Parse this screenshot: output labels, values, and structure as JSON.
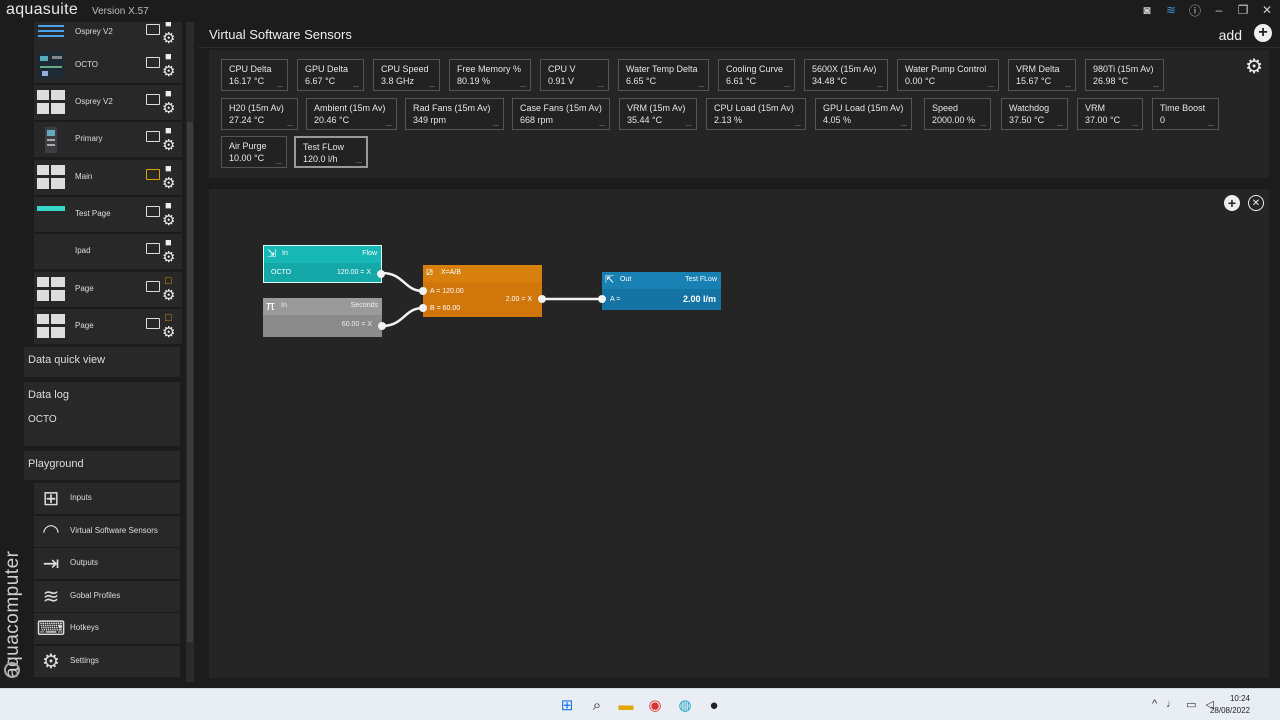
{
  "app": {
    "name": "aquasuite",
    "version": "Version X.57",
    "brand": "aquacomputer"
  },
  "pages": [
    {
      "label": "Osprey V2",
      "thumb": "blue-lines",
      "locked": true,
      "monitor_active": false
    },
    {
      "label": "OCTO",
      "thumb": "circuit",
      "locked": true,
      "monitor_active": false
    },
    {
      "label": "Osprey V2",
      "thumb": "grid",
      "locked": true,
      "monitor_active": false
    },
    {
      "label": "Primary",
      "thumb": "device",
      "locked": true,
      "monitor_active": false
    },
    {
      "label": "Main",
      "thumb": "grid",
      "locked": true,
      "monitor_active": true
    },
    {
      "label": "Test Page",
      "thumb": "teal-bar",
      "locked": true,
      "monitor_active": false
    },
    {
      "label": "Ipad",
      "thumb": "blank",
      "locked": true,
      "monitor_active": false
    },
    {
      "label": "Page",
      "thumb": "grid",
      "locked": false,
      "monitor_active": false
    },
    {
      "label": "Page",
      "thumb": "grid",
      "locked": false,
      "monitor_active": false
    }
  ],
  "sections": {
    "quick_view": "Data quick view",
    "data_log": "Data log",
    "octo": "OCTO",
    "playground": "Playground"
  },
  "nav": [
    {
      "label": "Inputs",
      "icon": "sliders-icon",
      "glyph": "⊞"
    },
    {
      "label": "Virtual Software Sensors",
      "icon": "gauge-icon",
      "glyph": "◠"
    },
    {
      "label": "Outputs",
      "icon": "output-icon",
      "glyph": "⇥"
    },
    {
      "label": "Gobal Profiles",
      "icon": "layers-icon",
      "glyph": "≋"
    },
    {
      "label": "Hotkeys",
      "icon": "keyboard-icon",
      "glyph": "⌨"
    },
    {
      "label": "Settings",
      "icon": "gear-icon",
      "glyph": "⚙"
    }
  ],
  "header": {
    "title": "Virtual Software Sensors",
    "add_label": "add",
    "add_glyph": "+"
  },
  "sensors_row1": [
    {
      "name": "CPU Delta",
      "value": "16.17 °C"
    },
    {
      "name": "GPU Delta",
      "value": "6.67 °C"
    },
    {
      "name": "CPU Speed",
      "value": "3.8 GHz"
    },
    {
      "name": "Free Memory %",
      "value": "80.19 %"
    },
    {
      "name": "CPU V",
      "value": "0.91 V"
    },
    {
      "name": "Water Temp Delta",
      "value": "6.65 °C"
    },
    {
      "name": "Cooling Curve",
      "value": "6.61 °C"
    },
    {
      "name": "5600X (15m Av)",
      "value": "34.48 °C"
    },
    {
      "name": "Water Pump Control",
      "value": "0.00 °C"
    },
    {
      "name": "VRM Delta",
      "value": "15.67 °C"
    },
    {
      "name": "980Ti (15m Av)",
      "value": "26.98 °C"
    }
  ],
  "sensors_row2": [
    {
      "name": "H20 (15m Av)",
      "value": "27.24 °C"
    },
    {
      "name": "Ambient (15m Av)",
      "value": "20.46 °C"
    },
    {
      "name": "Rad Fans (15m Av)",
      "value": "349 rpm"
    },
    {
      "name": "Case Fans (15m Av)",
      "value": "668 rpm"
    },
    {
      "name": "VRM (15m Av)",
      "value": "35.44 °C"
    },
    {
      "name": "CPU Load (15m Av)",
      "value": "2.13 %"
    },
    {
      "name": "GPU Load (15m Av)",
      "value": "4.05 %"
    },
    {
      "name": "Speed",
      "value": "2000.00 %"
    },
    {
      "name": "Watchdog",
      "value": "37.50 °C"
    },
    {
      "name": "VRM",
      "value": "37.00 °C"
    },
    {
      "name": "Time Boost",
      "value": "0"
    }
  ],
  "sensors_row3": [
    {
      "name": "Air Purge",
      "value": "10.00 °C"
    },
    {
      "name": "Test FLow",
      "value": "120.0 l/h"
    }
  ],
  "tile_more": "...",
  "nodes": {
    "flow": {
      "kind": "In",
      "name": "Flow",
      "source": "OCTO",
      "output": "120.00 = X"
    },
    "seconds": {
      "kind": "In",
      "name": "Seconds",
      "output": "60.00 = X"
    },
    "divide": {
      "formula": "X=A/B",
      "a": "A = 120.00",
      "b": "B = 60.00",
      "result": "2.00 = X"
    },
    "out": {
      "kind": "Out",
      "name": "Test FLow",
      "input": "A =",
      "value": "2.00 l/m"
    }
  },
  "taskbar": {
    "time": "10:24",
    "date": "28/08/2022"
  },
  "colors": {
    "flow_node": "#14a8a8",
    "divide_node": "#d0760a",
    "out_node": "#1474a4",
    "in_node_gray": "#8b8b8b"
  }
}
